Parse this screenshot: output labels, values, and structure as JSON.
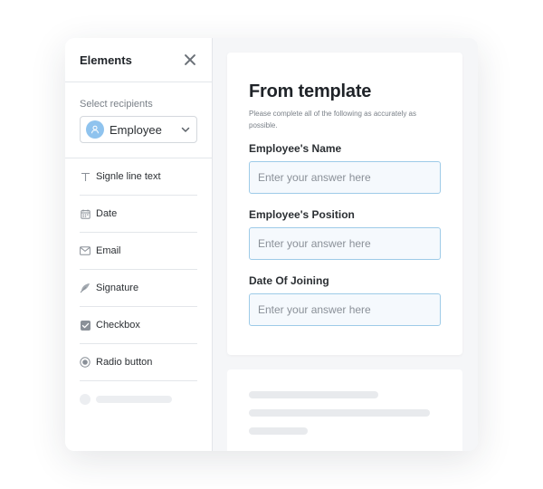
{
  "sidebar": {
    "title": "Elements",
    "recipients": {
      "label": "Select recipients",
      "selected": "Employee"
    },
    "items": [
      {
        "label": "Signle line text",
        "icon": "text-icon"
      },
      {
        "label": "Date",
        "icon": "calendar-icon"
      },
      {
        "label": "Email",
        "icon": "envelope-icon"
      },
      {
        "label": "Signature",
        "icon": "feather-icon"
      },
      {
        "label": "Checkbox",
        "icon": "checkbox-icon"
      },
      {
        "label": "Radio button",
        "icon": "radio-icon"
      }
    ]
  },
  "form": {
    "title": "From template",
    "subtitle": "Please complete all of the following as accurately as possible.",
    "fields": [
      {
        "label": "Employee's Name",
        "placeholder": "Enter your answer here"
      },
      {
        "label": "Employee's Position",
        "placeholder": "Enter your answer here"
      },
      {
        "label": "Date Of Joining",
        "placeholder": "Enter your answer here"
      }
    ]
  },
  "colors": {
    "accent_border": "#9ecbe8",
    "field_bg": "#f5f9fd",
    "avatar": "#8fc3ee"
  }
}
